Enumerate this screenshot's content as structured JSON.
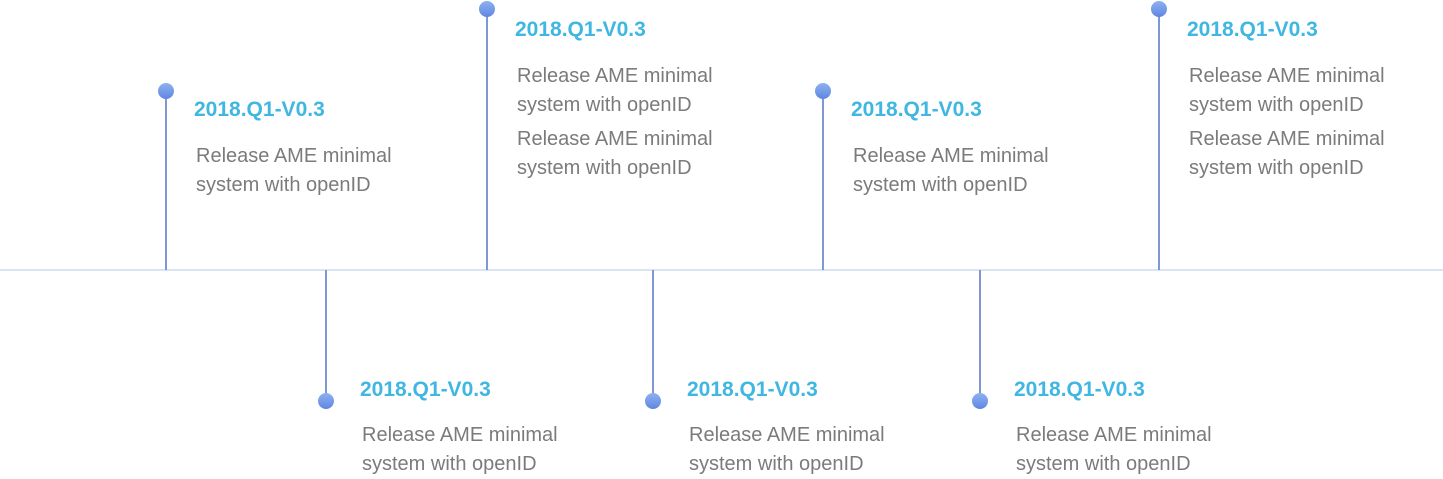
{
  "timeline": {
    "milestones": [
      {
        "title": "2018.Q1-V0.3",
        "lines": [
          "Release AME minimal system with openID"
        ]
      },
      {
        "title": "2018.Q1-V0.3",
        "lines": [
          "Release AME minimal system with openID"
        ]
      },
      {
        "title": "2018.Q1-V0.3",
        "lines": [
          "Release AME minimal system with openID",
          "Release AME minimal system with openID"
        ]
      },
      {
        "title": "2018.Q1-V0.3",
        "lines": [
          "Release AME minimal system with openID"
        ]
      },
      {
        "title": "2018.Q1-V0.3",
        "lines": [
          "Release AME minimal system with openID"
        ]
      },
      {
        "title": "2018.Q1-V0.3",
        "lines": [
          "Release AME minimal system with openID"
        ]
      },
      {
        "title": "2018.Q1-V0.3",
        "lines": [
          "Release AME minimal system with openID"
        ]
      },
      {
        "title": "2018.Q1-V0.3",
        "lines": [
          "Release AME minimal system with openID",
          "Release AME minimal system with openID"
        ]
      }
    ],
    "colors": {
      "title": "#3fb7e2",
      "text": "#7b7b7b",
      "stem": "#7f97d6",
      "axis": "#dbe4f3",
      "dot": "#6d93e6"
    }
  }
}
